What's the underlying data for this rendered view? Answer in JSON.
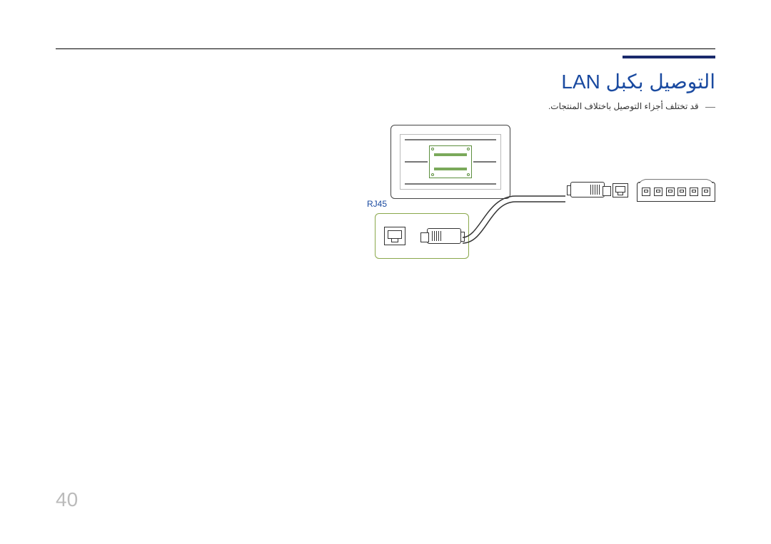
{
  "title": "التوصيل بكبل LAN",
  "note": "قد تختلف أجزاء التوصيل باختلاف المنتجات.",
  "port_label": "RJ45",
  "page_number": "40"
}
